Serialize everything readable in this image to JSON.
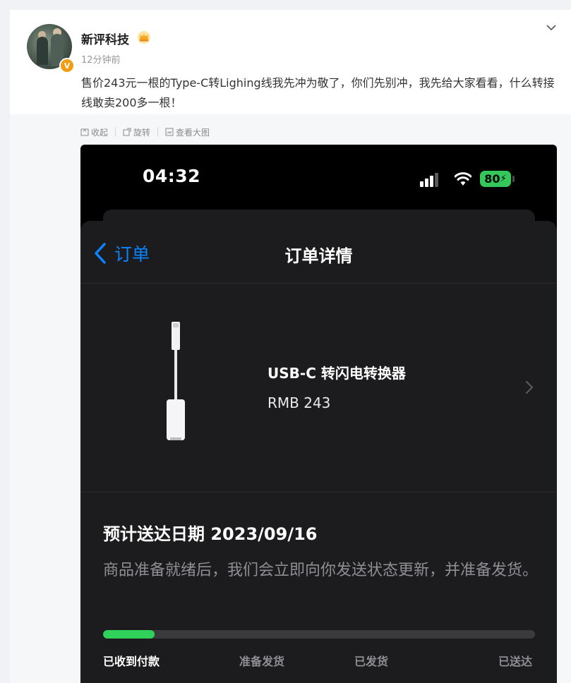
{
  "post": {
    "username": "新评科技",
    "time": "12分钟前",
    "text": "售价243元一根的Type-C转Lighing线我先冲为敬了，你们先别冲，我先给大家看看，什么转接线敢卖200多一根！",
    "verified_badge": "V"
  },
  "toolbar": {
    "collapse": "收起",
    "rotate": "旋转",
    "view_large": "查看大图"
  },
  "phone": {
    "status": {
      "time": "04:32",
      "battery": "80"
    },
    "nav": {
      "back_label": "订单",
      "title": "订单详情"
    },
    "product": {
      "name": "USB-C 转闪电转换器",
      "price": "RMB 243"
    },
    "delivery_title": "预计送达日期 2023/09/16",
    "delivery_desc": "商品准备就绪后，我们会立即向你发送状态更新，并准备发货。",
    "progress_fraction": 0.12,
    "stages": [
      "已收到付款",
      "准备发货",
      "已发货",
      "已送达"
    ]
  },
  "colors": {
    "accent_blue": "#0a84ff",
    "progress_green": "#30d158",
    "battery_green": "#34c759",
    "verified_orange": "#f39c12"
  },
  "icons": [
    "crown-icon",
    "chevron-down-icon",
    "collapse-icon",
    "rotate-icon",
    "view-large-icon",
    "signal-icon",
    "wifi-icon",
    "battery-icon",
    "back-chevron-icon",
    "chevron-right-icon"
  ]
}
